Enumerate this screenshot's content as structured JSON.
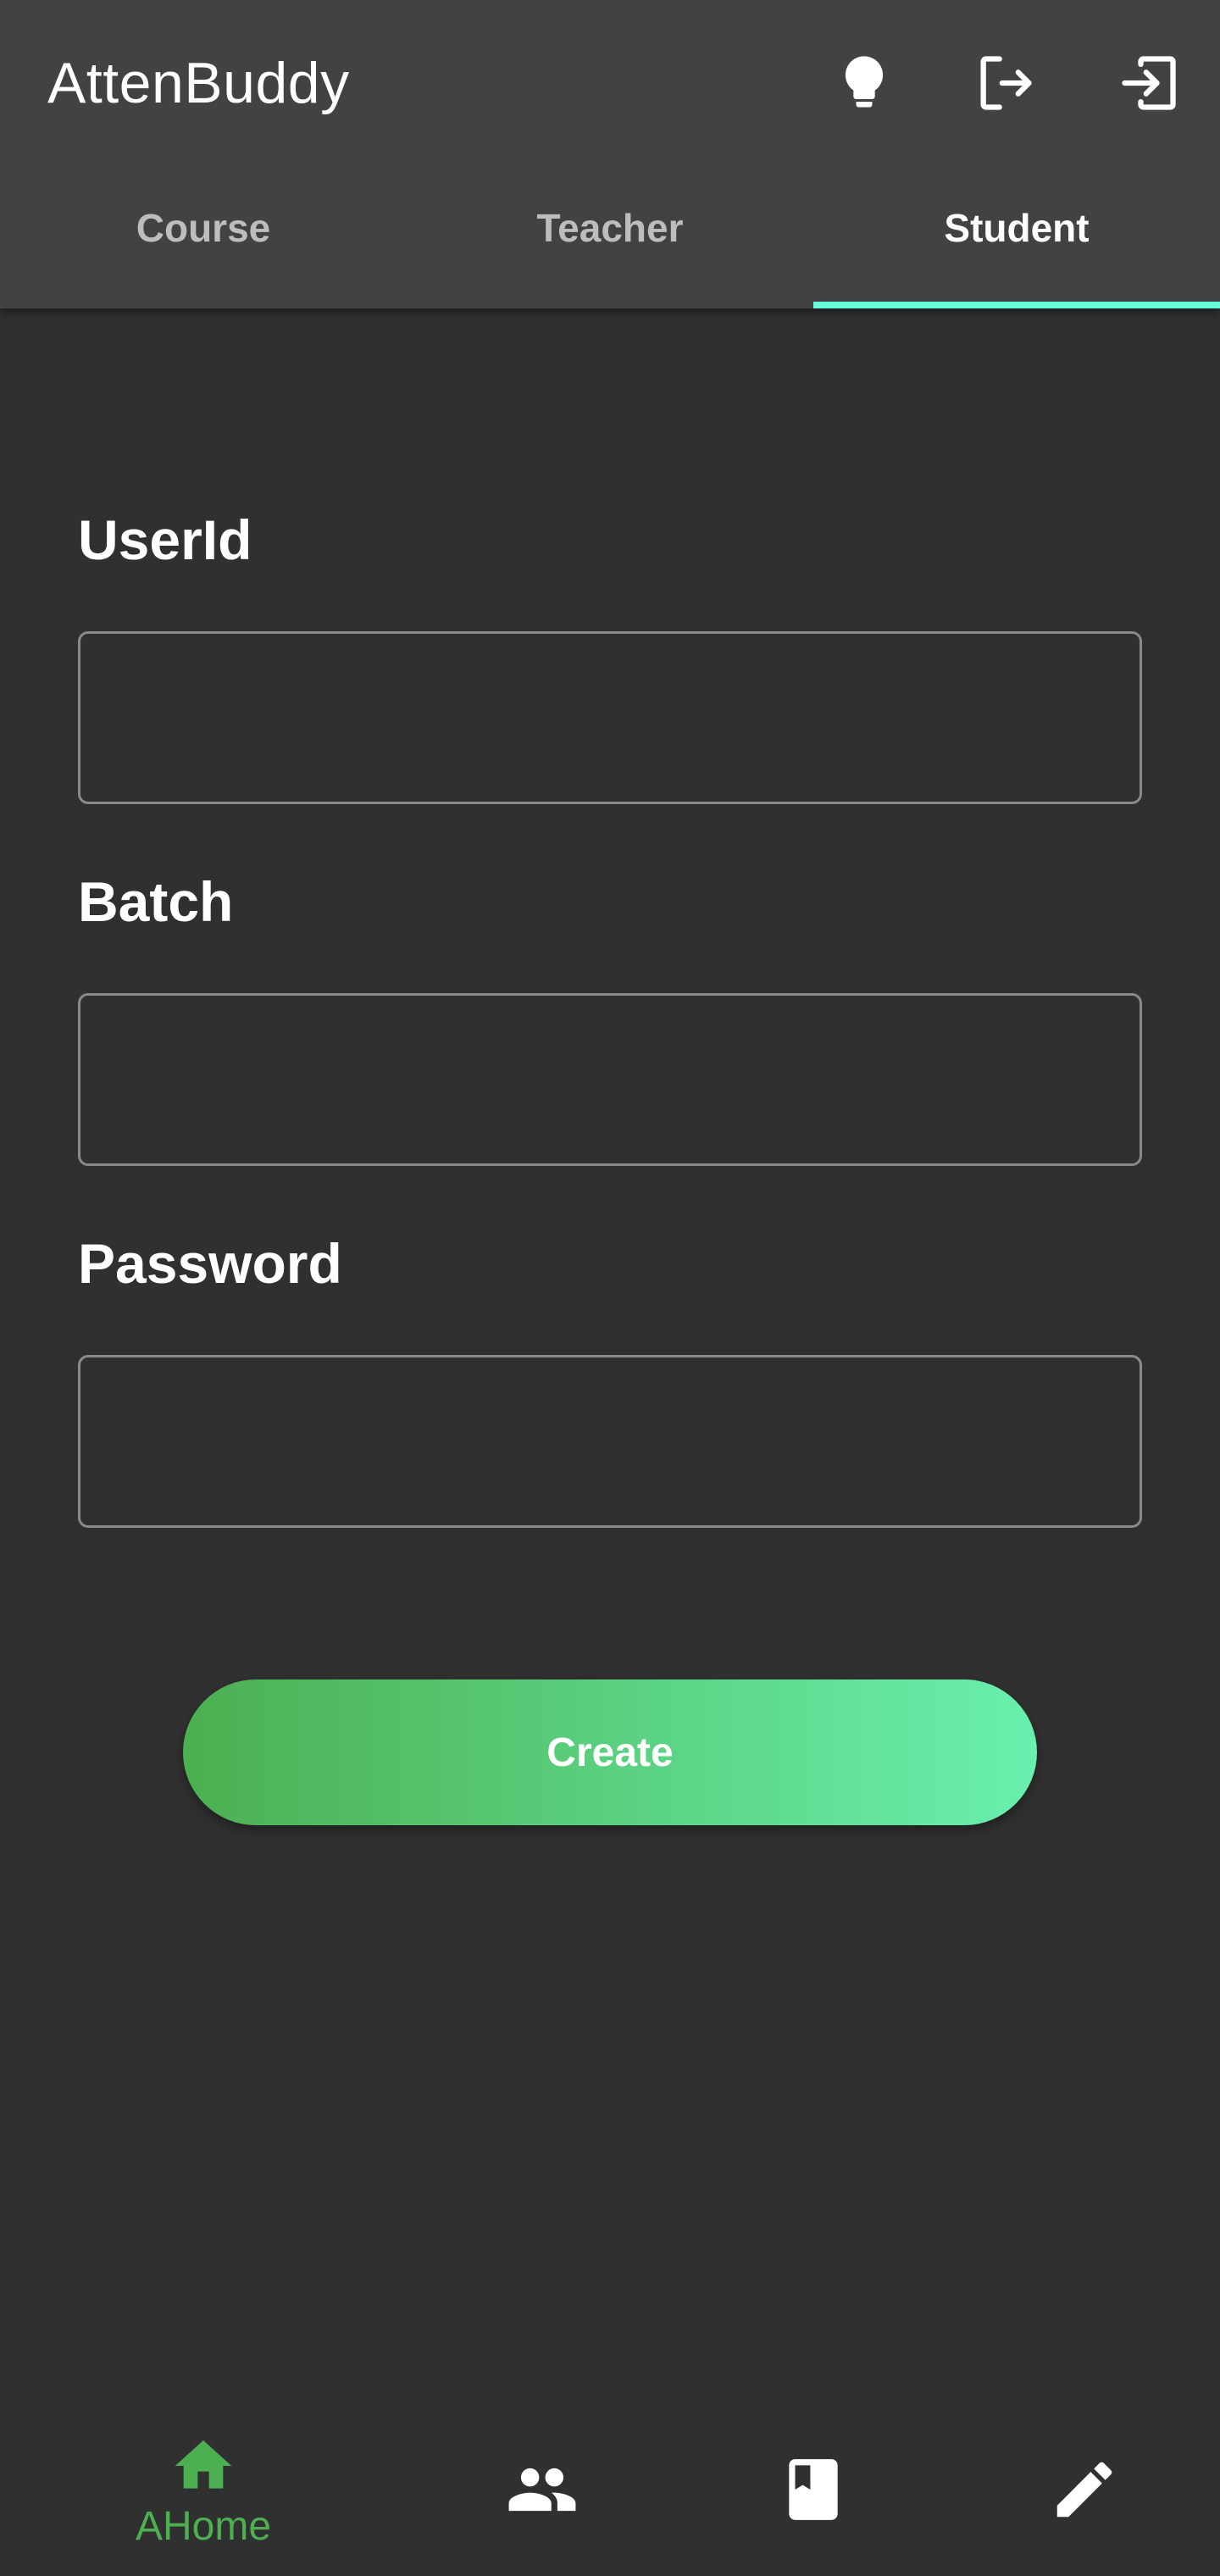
{
  "app": {
    "title": "AttenBuddy"
  },
  "toolbar": {
    "actions": [
      {
        "icon": "lightbulb-icon"
      },
      {
        "icon": "logout-icon"
      },
      {
        "icon": "login-icon"
      }
    ]
  },
  "tabs": [
    {
      "label": "Course",
      "active": false
    },
    {
      "label": "Teacher",
      "active": false
    },
    {
      "label": "Student",
      "active": true
    }
  ],
  "form": {
    "userid_label": "UserId",
    "userid_value": "",
    "batch_label": "Batch",
    "batch_value": "",
    "password_label": "Password",
    "password_value": "",
    "create_label": "Create"
  },
  "bottom_nav": {
    "items": [
      {
        "label": "AHome",
        "icon": "home-icon",
        "selected": true
      },
      {
        "label": "",
        "icon": "people-icon",
        "selected": false
      },
      {
        "label": "",
        "icon": "book-icon",
        "selected": false
      },
      {
        "label": "",
        "icon": "pencil-icon",
        "selected": false
      }
    ]
  },
  "colors": {
    "background": "#303030",
    "appbar": "#424242",
    "tab_indicator": "#64ffda",
    "accent_green": "#4caf50",
    "gradient_end": "#69f0ae"
  }
}
